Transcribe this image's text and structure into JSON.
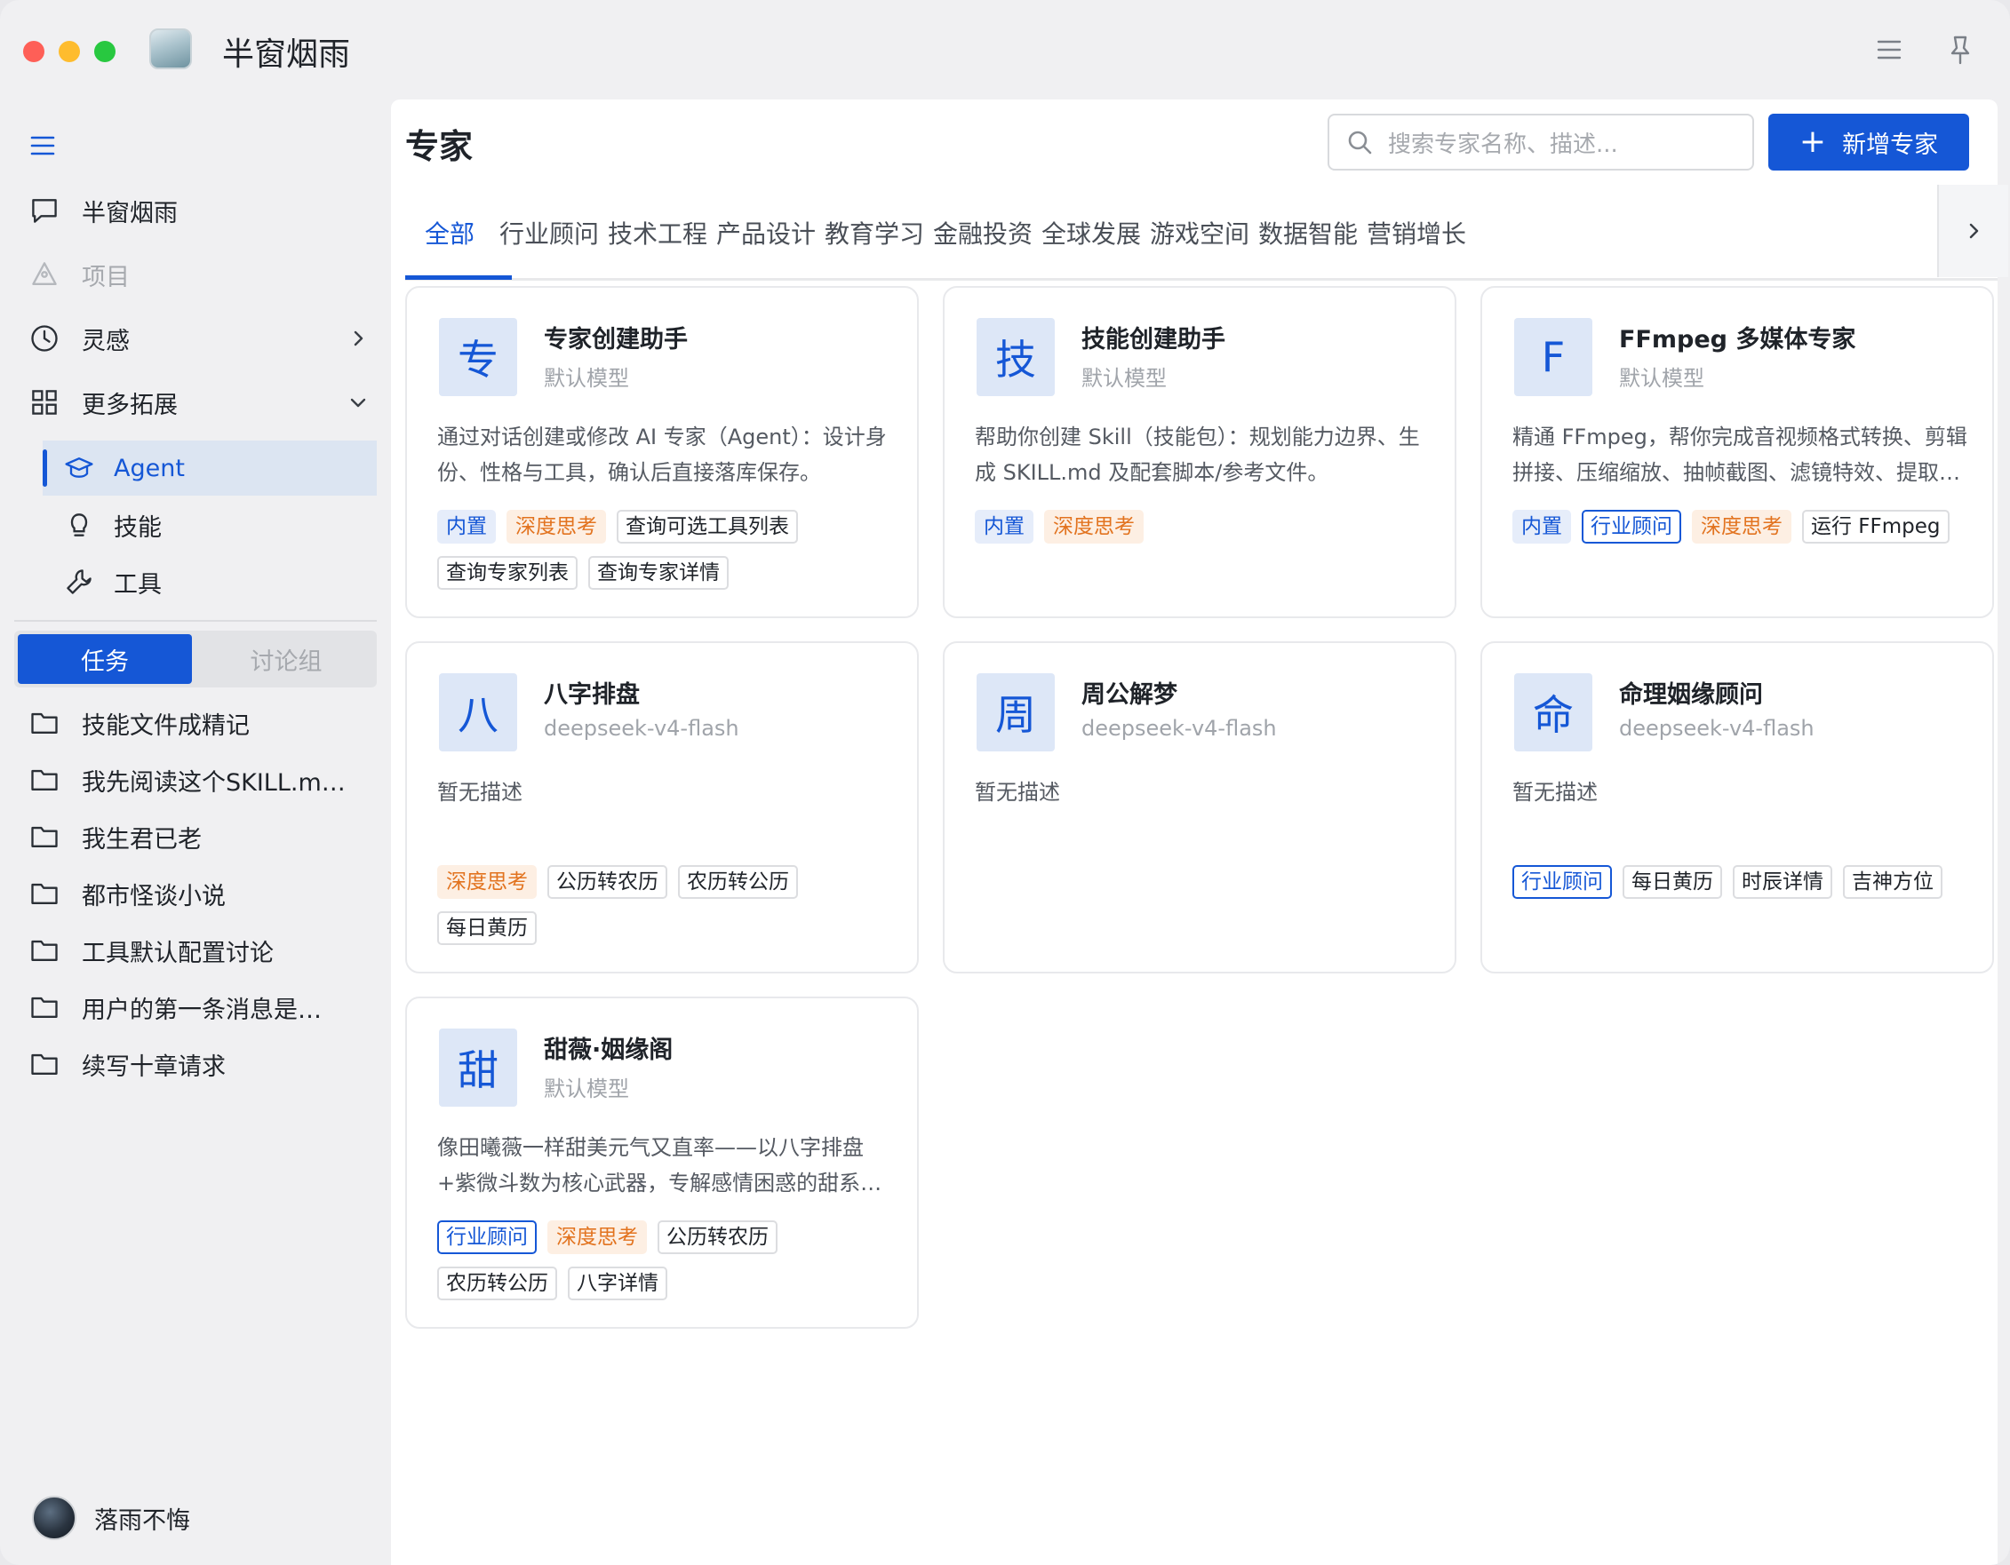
{
  "app": {
    "title": "半窗烟雨"
  },
  "sidebar": {
    "nav": [
      {
        "label": "半窗烟雨",
        "icon": "chat-bubble-icon"
      },
      {
        "label": "项目",
        "icon": "triangle-nodes-icon"
      },
      {
        "label": "灵感",
        "icon": "clock-icon"
      },
      {
        "label": "更多拓展",
        "icon": "grid-icon"
      }
    ],
    "extensions": [
      {
        "label": "Agent",
        "icon": "graduation-cap-icon",
        "active": true
      },
      {
        "label": "技能",
        "icon": "lightbulb-icon"
      },
      {
        "label": "工具",
        "icon": "wrench-icon"
      }
    ],
    "segments": [
      "任务",
      "讨论组"
    ],
    "tasks": [
      "技能文件成精记",
      "我先阅读这个SKILL.m…",
      "我生君已老",
      "都市怪谈小说",
      "工具默认配置讨论",
      "用户的第一条消息是…",
      "续写十章请求"
    ],
    "user": {
      "name": "落雨不悔"
    }
  },
  "main": {
    "title": "专家",
    "search_placeholder": "搜索专家名称、描述...",
    "add_label": "新增专家",
    "tabs": [
      "全部",
      "行业顾问",
      "技术工程",
      "产品设计",
      "教育学习",
      "金融投资",
      "全球发展",
      "游戏空间",
      "数据智能",
      "营销增长"
    ],
    "cards": [
      {
        "icon": "专",
        "name": "专家创建助手",
        "model": "默认模型",
        "desc": "通过对话创建或修改 AI 专家（Agent）：设计身份、性格与工具，确认后直接落库保存。",
        "tags": [
          {
            "t": "内置",
            "k": "builtin"
          },
          {
            "t": "深度思考",
            "k": "deep"
          },
          {
            "t": "查询可选工具列表",
            "k": ""
          },
          {
            "t": "查询专家列表",
            "k": ""
          },
          {
            "t": "查询专家详情",
            "k": ""
          }
        ]
      },
      {
        "icon": "技",
        "name": "技能创建助手",
        "model": "默认模型",
        "desc": "帮助你创建 Skill（技能包）：规划能力边界、生成 SKILL.md 及配套脚本/参考文件。",
        "tags": [
          {
            "t": "内置",
            "k": "builtin"
          },
          {
            "t": "深度思考",
            "k": "deep"
          }
        ]
      },
      {
        "icon": "F",
        "name": "FFmpeg 多媒体专家",
        "model": "默认模型",
        "desc": "精通 FFmpeg，帮你完成音视频格式转换、剪辑拼接、压缩缩放、抽帧截图、滤镜特效、提取…",
        "tags": [
          {
            "t": "内置",
            "k": "builtin"
          },
          {
            "t": "行业顾问",
            "k": "industry"
          },
          {
            "t": "深度思考",
            "k": "deep"
          },
          {
            "t": "运行 FFmpeg",
            "k": ""
          }
        ]
      },
      {
        "icon": "八",
        "name": "八字排盘",
        "model": "deepseek-v4-flash",
        "desc": "暂无描述",
        "tags": [
          {
            "t": "深度思考",
            "k": "deep"
          },
          {
            "t": "公历转农历",
            "k": ""
          },
          {
            "t": "农历转公历",
            "k": ""
          },
          {
            "t": "每日黄历",
            "k": ""
          }
        ]
      },
      {
        "icon": "周",
        "name": "周公解梦",
        "model": "deepseek-v4-flash",
        "desc": "暂无描述",
        "tags": []
      },
      {
        "icon": "命",
        "name": "命理姻缘顾问",
        "model": "deepseek-v4-flash",
        "desc": "暂无描述",
        "tags": [
          {
            "t": "行业顾问",
            "k": "industry"
          },
          {
            "t": "每日黄历",
            "k": ""
          },
          {
            "t": "时辰详情",
            "k": ""
          },
          {
            "t": "吉神方位",
            "k": ""
          }
        ]
      },
      {
        "icon": "甜",
        "name": "甜薇·姻缘阁",
        "model": "默认模型",
        "desc": "像田曦薇一样甜美元气又直率——以八字排盘+紫微斗数为核心武器，专解感情困惑的甜系…",
        "tags": [
          {
            "t": "行业顾问",
            "k": "industry"
          },
          {
            "t": "深度思考",
            "k": "deep"
          },
          {
            "t": "公历转农历",
            "k": ""
          },
          {
            "t": "农历转公历",
            "k": ""
          },
          {
            "t": "八字详情",
            "k": ""
          }
        ]
      }
    ]
  }
}
